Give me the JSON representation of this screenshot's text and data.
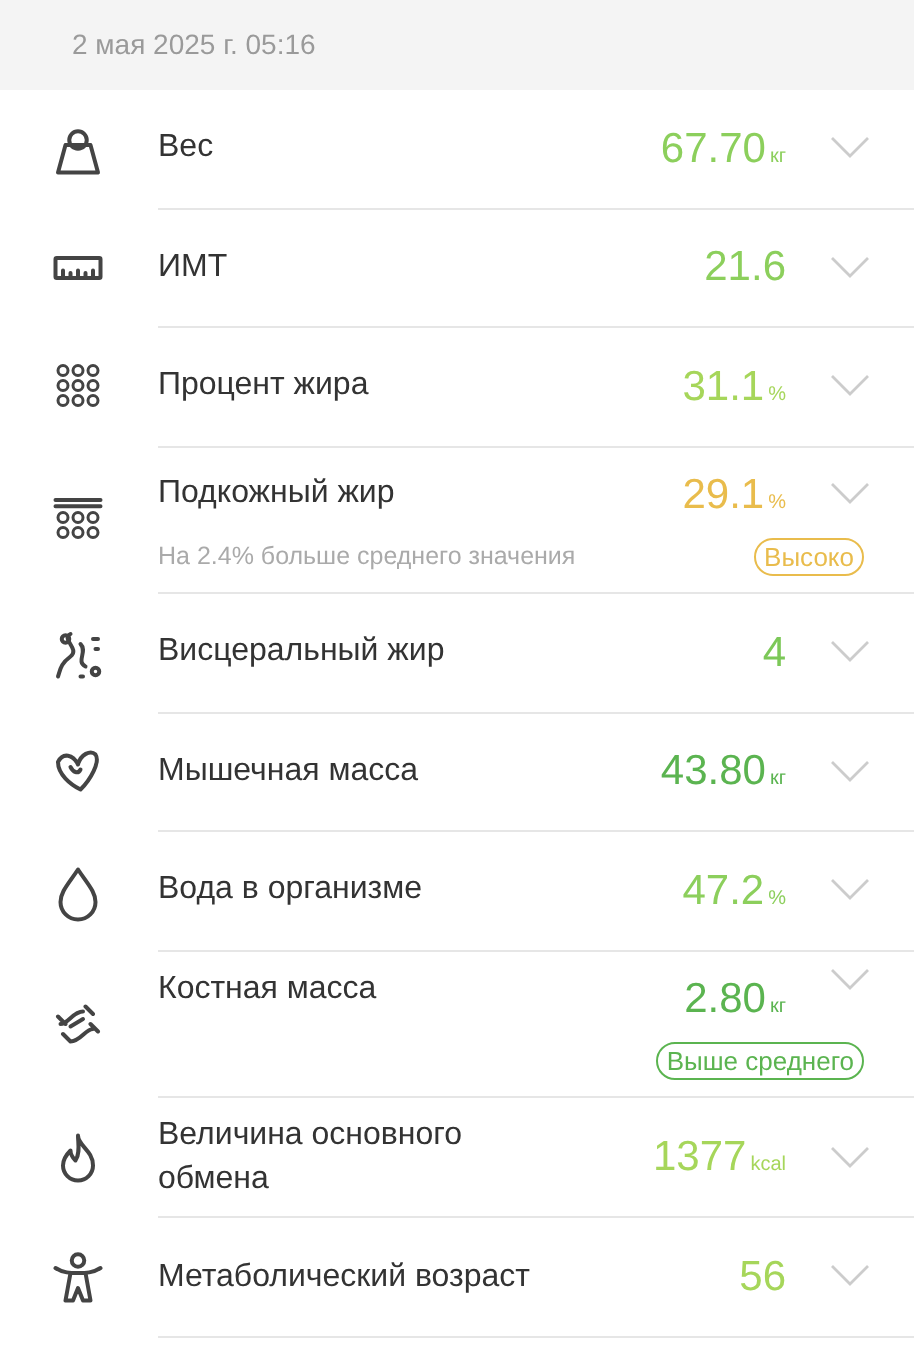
{
  "date_header": "2 мая 2025 г. 05:16",
  "metrics": [
    {
      "label": "Вес",
      "value": "67.70",
      "unit": "кг",
      "color": "#8ccf5c",
      "expanded": false
    },
    {
      "label": "ИМТ",
      "value": "21.6",
      "color": "#8ccf5c",
      "expanded": false
    },
    {
      "label": "Процент жира",
      "value": "31.1",
      "unit": "%",
      "color": "#a6d65a",
      "expanded": false
    },
    {
      "label": "Подкожный жир",
      "value": "29.1",
      "unit": "%",
      "color": "#e9bc4c",
      "expanded": false,
      "note": "На 2.4% больше среднего значения",
      "badge": {
        "text": "Высоко",
        "color": "#e9bc4c"
      }
    },
    {
      "label": "Висцеральный жир",
      "value": "4",
      "color": "#7cc858",
      "expanded": false
    },
    {
      "label": "Мышечная масса",
      "value": "43.80",
      "unit": "кг",
      "color": "#5bb450",
      "expanded": false
    },
    {
      "label": "Вода в организме",
      "value": "47.2",
      "unit": "%",
      "color": "#8ccf5c",
      "expanded": false
    },
    {
      "label": "Костная масса",
      "value": "2.80",
      "unit": "кг",
      "color": "#5bb450",
      "expanded": false,
      "badge": {
        "text": "Выше среднего",
        "color": "#5bb450"
      }
    },
    {
      "label": "Величина основного обмена",
      "value": "1377",
      "unit": "kcal",
      "color": "#a6d65a",
      "expanded": false
    },
    {
      "label": "Метаболический возраст",
      "value": "56",
      "color": "#a6d65a",
      "expanded": false
    }
  ]
}
